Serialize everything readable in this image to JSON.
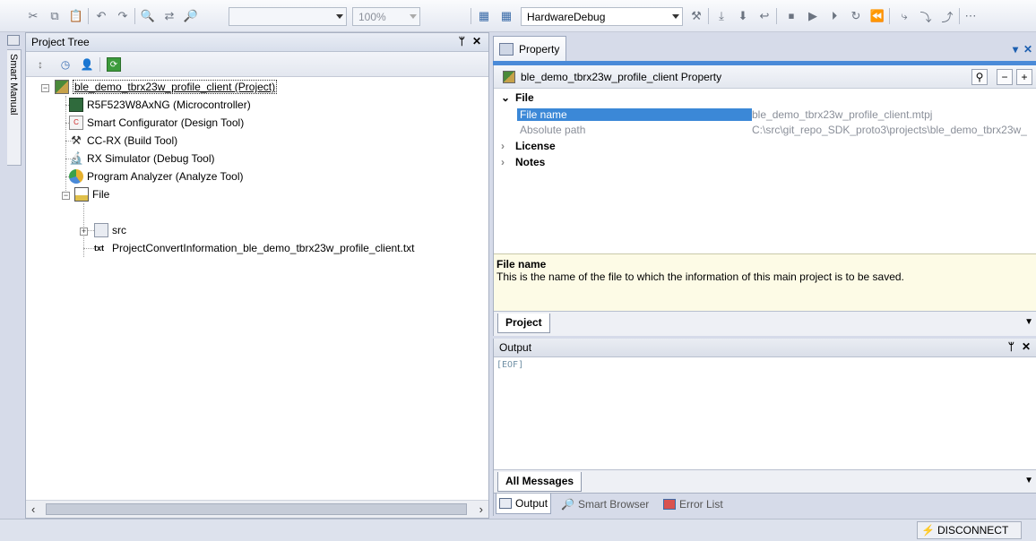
{
  "toolbar": {
    "zoom_value": "100%",
    "build_mode": "HardwareDebug"
  },
  "smart_manual": {
    "label": "Smart Manual"
  },
  "project_tree": {
    "title": "Project Tree",
    "pin_glyph": "📌",
    "close_glyph": "✕",
    "nodes": [
      {
        "label": "ble_demo_tbrx23w_profile_client (Project)",
        "icon": "project-icon"
      },
      {
        "label": "R5F523W8AxNG (Microcontroller)",
        "icon": "microcontroller-icon"
      },
      {
        "label": "Smart Configurator (Design Tool)",
        "icon": "smart-configurator-icon"
      },
      {
        "label": "CC-RX (Build Tool)",
        "icon": "build-tool-icon"
      },
      {
        "label": "RX Simulator (Debug Tool)",
        "icon": "debug-tool-icon"
      },
      {
        "label": "Program Analyzer (Analyze Tool)",
        "icon": "analyze-tool-icon"
      },
      {
        "label": "File",
        "icon": "folder-icon"
      },
      {
        "label": "src",
        "icon": "folder-icon"
      },
      {
        "label": "ProjectConvertInformation_ble_demo_tbrx23w_profile_client.txt",
        "icon": "txt-file-icon"
      }
    ],
    "expander_collapsed": "+",
    "expander_expanded": "−"
  },
  "property": {
    "tab_label": "Property",
    "title": "ble_demo_tbrx23w_profile_client Property",
    "categories": {
      "file": "File",
      "license": "License",
      "notes": "Notes"
    },
    "rows": [
      {
        "key": "File name",
        "value": "ble_demo_tbrx23w_profile_client.mtpj"
      },
      {
        "key": "Absolute path",
        "value": "C:\\src\\git_repo_SDK_proto3\\projects\\ble_demo_tbrx23w_"
      }
    ],
    "description": {
      "title": "File name",
      "text": "This is the name of the file to which the information of this main project is to be saved."
    },
    "subtab": "Project"
  },
  "output": {
    "title": "Output",
    "text": "[EOF]",
    "subtab": "All Messages",
    "bottom_tabs": [
      "Output",
      "Smart Browser",
      "Error List"
    ]
  },
  "status": {
    "disconnect_label": "DISCONNECT"
  },
  "colors": {
    "selection": "#3b88d7",
    "accent_line": "#4a8ad8",
    "description_bg": "#fdfbe6"
  }
}
